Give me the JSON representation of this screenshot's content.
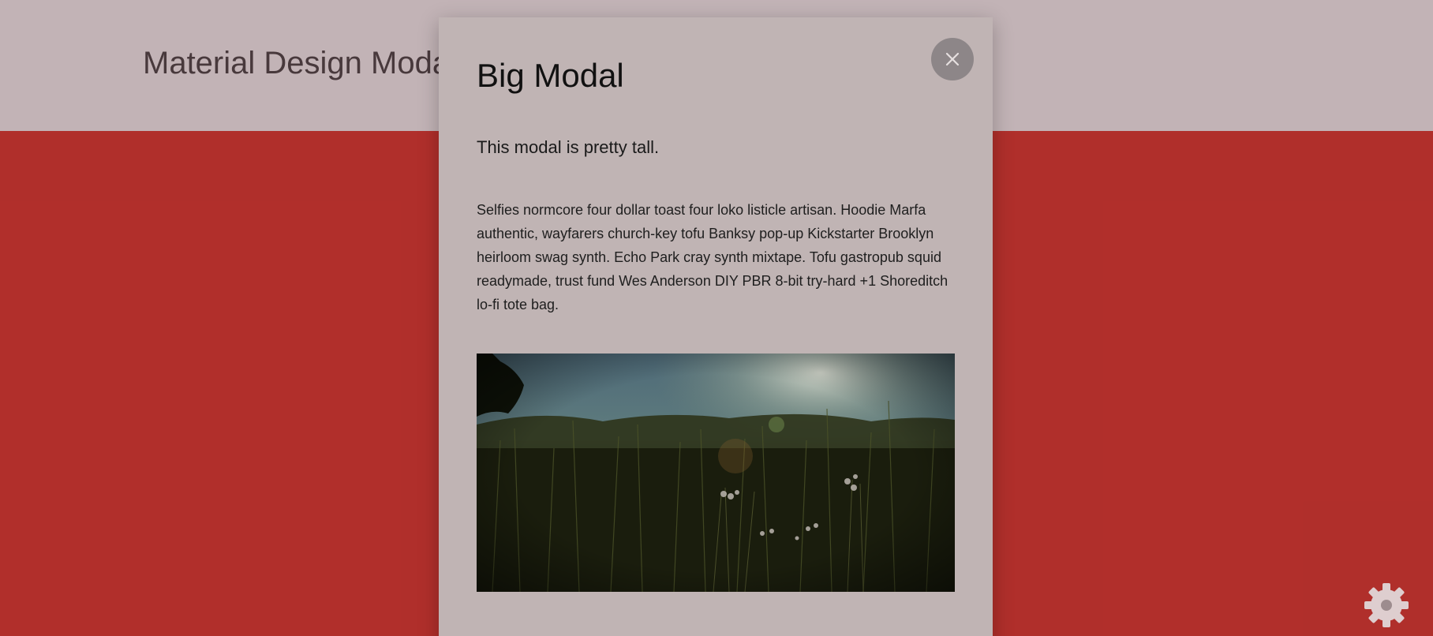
{
  "page": {
    "title": "Material Design Modal"
  },
  "colors": {
    "header_background": "#ffffff",
    "body_background": "#e53b30",
    "modal_background": "#c0b4b4",
    "close_button": "#8d8688"
  },
  "modal": {
    "title": "Big Modal",
    "subtitle": "This modal is pretty tall.",
    "paragraph": "Selfies normcore four dollar toast four loko listicle artisan. Hoodie Marfa authentic, wayfarers church-key tofu Banksy pop-up Kickstarter Brooklyn heirloom swag synth. Echo Park cray synth mixtape. Tofu gastropub squid readymade, trust fund Wes Anderson DIY PBR 8-bit try-hard +1 Shoreditch lo-fi tote bag.",
    "close_icon": "close-icon",
    "image_icon": "meadow-photo"
  },
  "widget": {
    "icon": "gear-icon"
  }
}
